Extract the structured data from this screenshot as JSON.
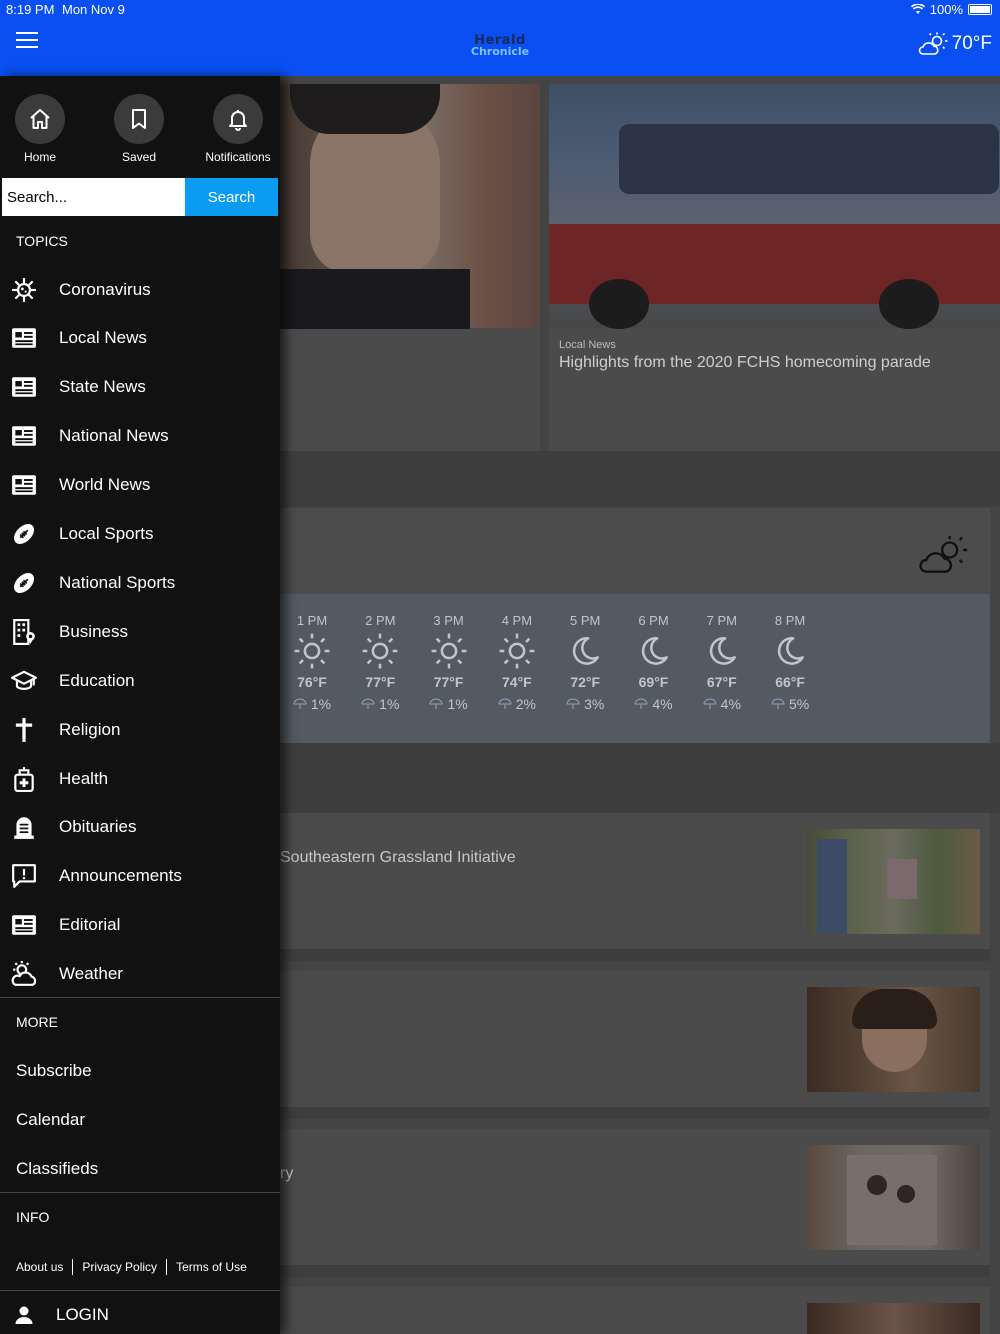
{
  "status": {
    "time": "8:19 PM",
    "date": "Mon Nov 9",
    "battery": "100%"
  },
  "header": {
    "logo_line1": "Herald",
    "logo_line2": "Chronicle",
    "temperature": "70°F",
    "weather_icon": "partly-cloudy-icon"
  },
  "drawer": {
    "quick_links": [
      {
        "label": "Home",
        "icon": "home-icon"
      },
      {
        "label": "Saved",
        "icon": "bookmark-icon"
      },
      {
        "label": "Notifications",
        "icon": "bell-icon"
      }
    ],
    "search": {
      "placeholder": "Search...",
      "button": "Search"
    },
    "topics_label": "TOPICS",
    "topics": [
      {
        "label": "Coronavirus",
        "icon": "virus-icon"
      },
      {
        "label": "Local News",
        "icon": "newspaper-icon"
      },
      {
        "label": "State News",
        "icon": "newspaper-icon"
      },
      {
        "label": "National News",
        "icon": "newspaper-icon"
      },
      {
        "label": "World News",
        "icon": "newspaper-icon"
      },
      {
        "label": "Local Sports",
        "icon": "football-icon"
      },
      {
        "label": "National Sports",
        "icon": "football-icon"
      },
      {
        "label": "Business",
        "icon": "building-icon"
      },
      {
        "label": "Education",
        "icon": "graduation-cap-icon"
      },
      {
        "label": "Religion",
        "icon": "cross-icon"
      },
      {
        "label": "Health",
        "icon": "medical-bag-icon"
      },
      {
        "label": "Obituaries",
        "icon": "gravestone-icon"
      },
      {
        "label": "Announcements",
        "icon": "announcement-icon"
      },
      {
        "label": "Editorial",
        "icon": "newspaper-icon"
      },
      {
        "label": "Weather",
        "icon": "weather-icon"
      }
    ],
    "more_label": "MORE",
    "more": [
      "Subscribe",
      "Calendar",
      "Classifieds"
    ],
    "info_label": "INFO",
    "info_links": [
      "About us",
      "Privacy Policy",
      "Terms of Use"
    ],
    "login": "LOGIN"
  },
  "content": {
    "featured": {
      "section": "Local News",
      "title": "Highlights from the 2020 FCHS homecoming parade"
    },
    "forecast": [
      {
        "time": "1 PM",
        "icon": "sun",
        "temp": "76°F",
        "rain": "1%"
      },
      {
        "time": "2 PM",
        "icon": "sun",
        "temp": "77°F",
        "rain": "1%"
      },
      {
        "time": "3 PM",
        "icon": "sun",
        "temp": "77°F",
        "rain": "1%"
      },
      {
        "time": "4 PM",
        "icon": "sun",
        "temp": "74°F",
        "rain": "2%"
      },
      {
        "time": "5 PM",
        "icon": "moon",
        "temp": "72°F",
        "rain": "3%"
      },
      {
        "time": "6 PM",
        "icon": "moon",
        "temp": "69°F",
        "rain": "4%"
      },
      {
        "time": "7 PM",
        "icon": "moon",
        "temp": "67°F",
        "rain": "4%"
      },
      {
        "time": "8 PM",
        "icon": "moon",
        "temp": "66°F",
        "rain": "5%"
      }
    ],
    "article1_title_fragment": "Southeastern Grassland Initiative",
    "article3_title_fragment": "ry"
  },
  "colors": {
    "header_blue": "#0a4ff1",
    "search_blue": "#0a9cf2",
    "drawer_bg": "#111111"
  }
}
